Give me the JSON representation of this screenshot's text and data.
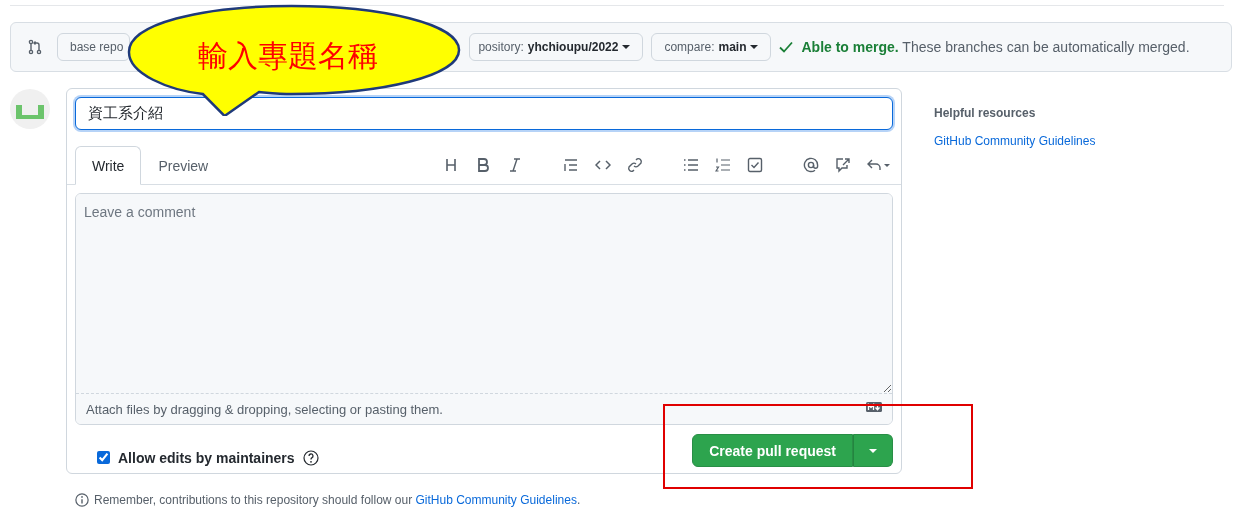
{
  "compare_bar": {
    "base_button": "base repo",
    "head_button": {
      "prefix": "pository:",
      "value": "yhchioupu/2022"
    },
    "compare_button": {
      "prefix": "compare:",
      "value": "main"
    },
    "merge_status": {
      "ok": true,
      "title": "Able to merge.",
      "text": "These branches can be automatically merged."
    }
  },
  "callout": {
    "text": "輸入專題名稱"
  },
  "form": {
    "title_value": "資工系介紹",
    "tabs": [
      {
        "label": "Write",
        "selected": true
      },
      {
        "label": "Preview",
        "selected": false
      }
    ],
    "comment_placeholder": "Leave a comment",
    "attach_hint": "Attach files by dragging & dropping, selecting or pasting them.",
    "allow_edits": {
      "label": "Allow edits by maintainers",
      "checked": true
    },
    "submit_button": "Create pull request"
  },
  "footer": {
    "text": "Remember, contributions to this repository should follow our",
    "link": "GitHub Community Guidelines",
    "end": "."
  },
  "sidebar": {
    "heading": "Helpful resources",
    "link": "GitHub Community Guidelines"
  },
  "highlight_box": {
    "shown": true
  }
}
